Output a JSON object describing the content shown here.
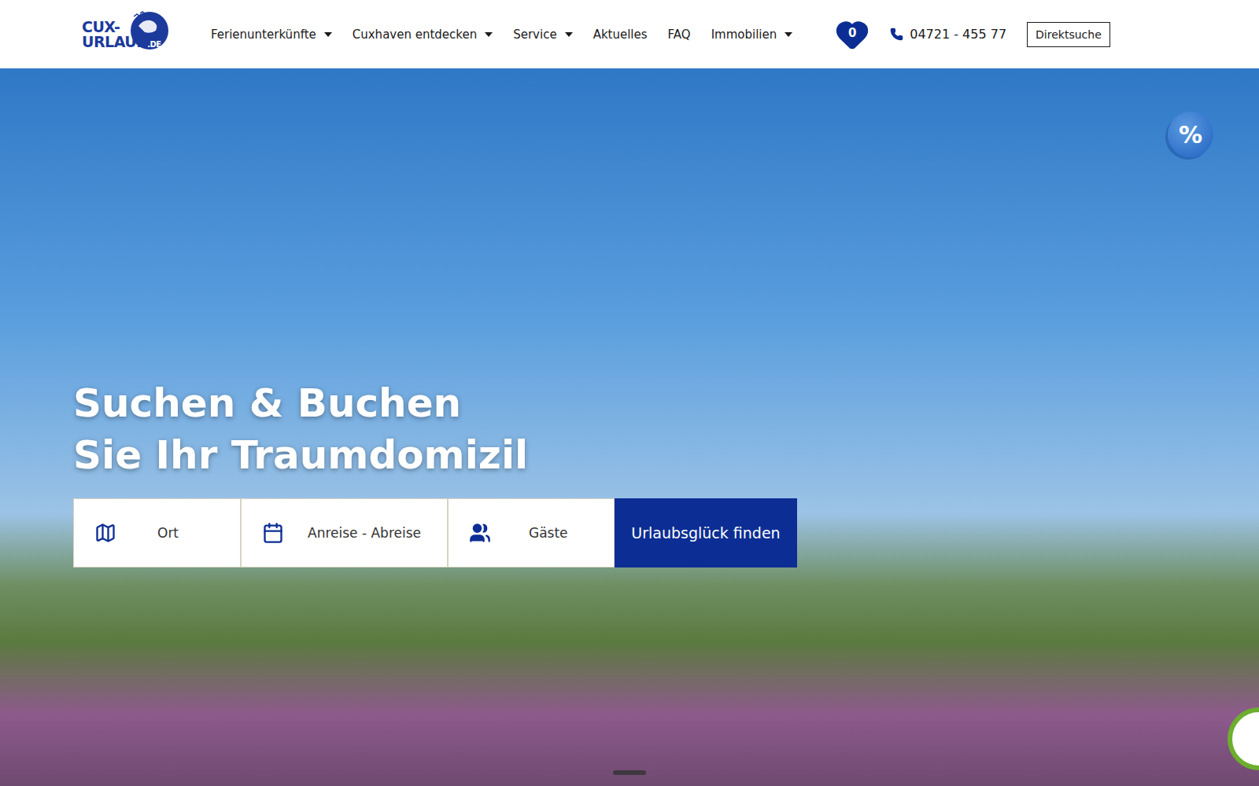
{
  "logo": {
    "line1": "CUX-",
    "line2": "URLAUB",
    "suffix": ".DE"
  },
  "nav": [
    {
      "label": "Ferienunterkünfte",
      "dropdown": true
    },
    {
      "label": "Cuxhaven entdecken",
      "dropdown": true
    },
    {
      "label": "Service",
      "dropdown": true
    },
    {
      "label": "Aktuelles",
      "dropdown": false
    },
    {
      "label": "FAQ",
      "dropdown": false
    },
    {
      "label": "Immobilien",
      "dropdown": true
    }
  ],
  "favorites": {
    "count": "0"
  },
  "phone": "04721 - 455 77",
  "direct_search": "Direktsuche",
  "hero": {
    "title_lines": [
      "Suchen & Buchen",
      "Sie Ihr Traumdomizil"
    ]
  },
  "search": {
    "fields": [
      {
        "kind": "place",
        "placeholder": "Ort"
      },
      {
        "kind": "dates",
        "placeholder": "Anreise - Abreise"
      },
      {
        "kind": "guests",
        "placeholder": "Gäste"
      }
    ],
    "button": "Urlaubsglück finden"
  },
  "discount_badge": "%"
}
